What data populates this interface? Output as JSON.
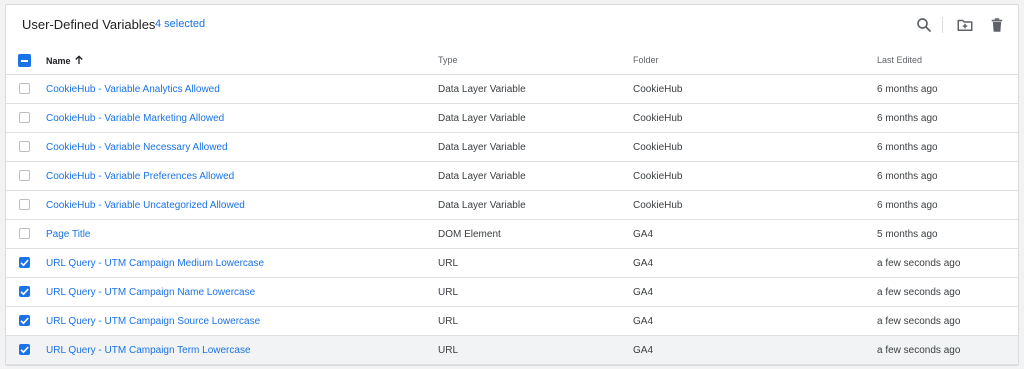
{
  "header": {
    "title": "User-Defined Variables",
    "selected_count": "4 selected",
    "icons": [
      "search-icon",
      "add-to-folder-icon",
      "delete-icon"
    ]
  },
  "columns": {
    "name": "Name",
    "type": "Type",
    "folder": "Folder",
    "last_edited": "Last Edited"
  },
  "colors": {
    "accent": "#1a73e8",
    "link": "#1a73e8",
    "border": "#dadce0"
  },
  "rows": [
    {
      "name": "CookieHub - Variable Analytics Allowed",
      "type": "Data Layer Variable",
      "folder": "CookieHub",
      "edited": "6 months ago",
      "checked": false
    },
    {
      "name": "CookieHub - Variable Marketing Allowed",
      "type": "Data Layer Variable",
      "folder": "CookieHub",
      "edited": "6 months ago",
      "checked": false
    },
    {
      "name": "CookieHub - Variable Necessary Allowed",
      "type": "Data Layer Variable",
      "folder": "CookieHub",
      "edited": "6 months ago",
      "checked": false
    },
    {
      "name": "CookieHub - Variable Preferences Allowed",
      "type": "Data Layer Variable",
      "folder": "CookieHub",
      "edited": "6 months ago",
      "checked": false
    },
    {
      "name": "CookieHub - Variable Uncategorized Allowed",
      "type": "Data Layer Variable",
      "folder": "CookieHub",
      "edited": "6 months ago",
      "checked": false
    },
    {
      "name": "Page Title",
      "type": "DOM Element",
      "folder": "GA4",
      "edited": "5 months ago",
      "checked": false
    },
    {
      "name": "URL Query - UTM Campaign Medium Lowercase",
      "type": "URL",
      "folder": "GA4",
      "edited": "a few seconds ago",
      "checked": true
    },
    {
      "name": "URL Query - UTM Campaign Name Lowercase",
      "type": "URL",
      "folder": "GA4",
      "edited": "a few seconds ago",
      "checked": true
    },
    {
      "name": "URL Query - UTM Campaign Source Lowercase",
      "type": "URL",
      "folder": "GA4",
      "edited": "a few seconds ago",
      "checked": true
    },
    {
      "name": "URL Query - UTM Campaign Term Lowercase",
      "type": "URL",
      "folder": "GA4",
      "edited": "a few seconds ago",
      "checked": true
    }
  ]
}
